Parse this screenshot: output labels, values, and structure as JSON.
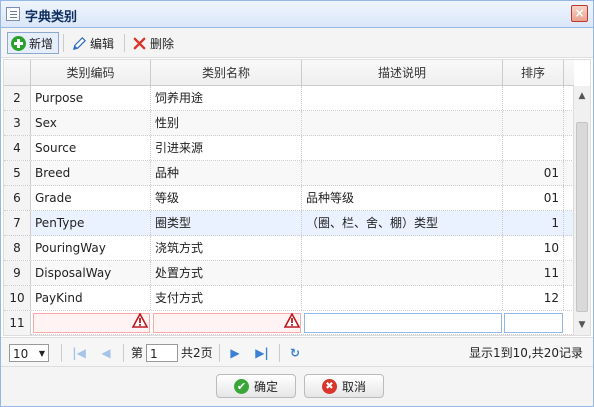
{
  "window": {
    "title": "字典类别",
    "close": "×"
  },
  "toolbar": {
    "add": "新增",
    "edit": "编辑",
    "delete": "删除"
  },
  "grid": {
    "columns": [
      "类别编码",
      "类别名称",
      "描述说明",
      "排序"
    ],
    "rows": [
      {
        "n": "2",
        "code": "Purpose",
        "name": "饲养用途",
        "desc": "",
        "sort": ""
      },
      {
        "n": "3",
        "code": "Sex",
        "name": "性别",
        "desc": "",
        "sort": ""
      },
      {
        "n": "4",
        "code": "Source",
        "name": "引进来源",
        "desc": "",
        "sort": ""
      },
      {
        "n": "5",
        "code": "Breed",
        "name": "品种",
        "desc": "",
        "sort": "01"
      },
      {
        "n": "6",
        "code": "Grade",
        "name": "等级",
        "desc": "品种等级",
        "sort": "01"
      },
      {
        "n": "7",
        "code": "PenType",
        "name": "圈类型",
        "desc": "（圈、栏、舍、棚）类型",
        "sort": "1"
      },
      {
        "n": "8",
        "code": "PouringWay",
        "name": "浇筑方式",
        "desc": "",
        "sort": "10"
      },
      {
        "n": "9",
        "code": "DisposalWay",
        "name": "处置方式",
        "desc": "",
        "sort": "11"
      },
      {
        "n": "10",
        "code": "PayKind",
        "name": "支付方式",
        "desc": "",
        "sort": "12"
      }
    ],
    "edit_row": {
      "n": "11"
    }
  },
  "pager": {
    "page_size": "10",
    "page_prefix": "第",
    "page_value": "1",
    "page_total": "共2页",
    "summary": "显示1到10,共20记录"
  },
  "footer": {
    "ok": "确定",
    "cancel": "取消"
  },
  "icons": {
    "add": "plus-circle-icon",
    "edit": "pencil-icon",
    "delete": "x-icon",
    "first": "first-page-icon",
    "prev": "prev-page-icon",
    "next": "next-page-icon",
    "last": "last-page-icon",
    "refresh": "refresh-icon",
    "warning": "warning-icon",
    "ok": "check-icon",
    "cancel": "cancel-icon"
  },
  "colors": {
    "accent": "#95b8e7",
    "title": "#0e2d5f",
    "pager_icon": "#3b7fd6"
  }
}
